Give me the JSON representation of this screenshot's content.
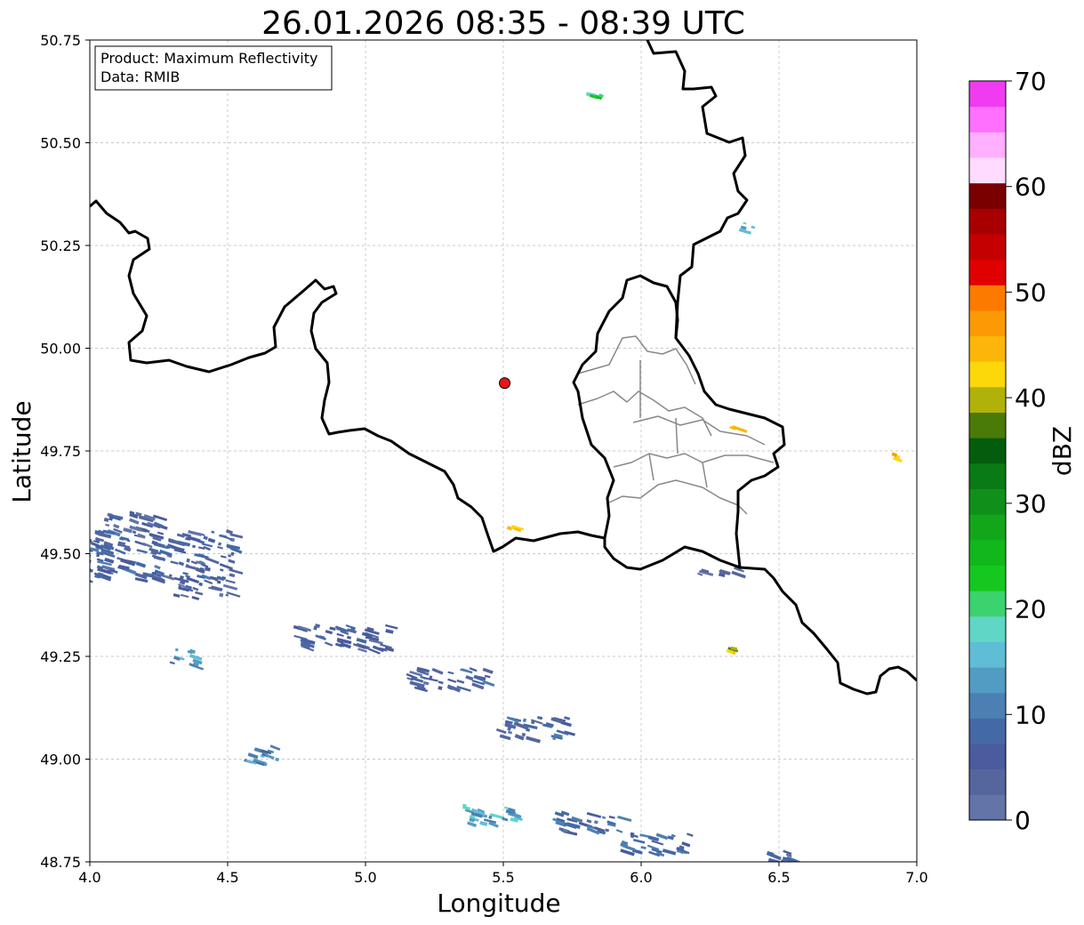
{
  "title": "26.01.2026 08:35 - 08:39 UTC",
  "legend": {
    "product_line": "Product: Maximum Reflectivity",
    "data_line": "Data: RMIB"
  },
  "axes": {
    "xlabel": "Longitude",
    "ylabel": "Latitude",
    "xlim": [
      4.0,
      7.0
    ],
    "ylim": [
      48.75,
      50.75
    ],
    "xticks": [
      "4.0",
      "4.5",
      "5.0",
      "5.5",
      "6.0",
      "6.5",
      "7.0"
    ],
    "yticks": [
      "48.75",
      "49.00",
      "49.25",
      "49.50",
      "49.75",
      "50.00",
      "50.25",
      "50.50",
      "50.75"
    ],
    "grid": true
  },
  "radar_site": {
    "lon": 5.505,
    "lat": 49.915,
    "color": "#e8151b"
  },
  "colorbar": {
    "label": "dBZ",
    "range": [
      0,
      70
    ],
    "tick_labels": [
      "0",
      "10",
      "20",
      "30",
      "40",
      "50",
      "60",
      "70"
    ],
    "colors": [
      "#6274a8",
      "#55669e",
      "#4a5c9d",
      "#4469a6",
      "#4c7fb2",
      "#529bc2",
      "#5fbdd6",
      "#5fd6c6",
      "#3bd36d",
      "#14c81f",
      "#12b71b",
      "#12a71a",
      "#10901a",
      "#0a7a15",
      "#045d0c",
      "#4a7a08",
      "#b0b20a",
      "#fcd70a",
      "#fcb60a",
      "#fc9a05",
      "#fc7a00",
      "#e00000",
      "#c40000",
      "#a80000",
      "#7a0000",
      "#ffdcff",
      "#ffb0ff",
      "#ff70ff",
      "#f03cf0"
    ]
  },
  "chart_data": {
    "type": "heatmap",
    "title": "26.01.2026 08:35 - 08:39 UTC",
    "xlabel": "Longitude",
    "ylabel": "Latitude",
    "xlim": [
      4.0,
      7.0
    ],
    "ylim": [
      48.75,
      50.75
    ],
    "value_label": "dBZ",
    "value_range": [
      0,
      70
    ],
    "echo_regions": [
      {
        "lon": 4.25,
        "lat": 49.5,
        "dlon": 0.55,
        "dlat": 0.12,
        "dbz": 6
      },
      {
        "lon": 4.15,
        "lat": 49.58,
        "dlon": 0.2,
        "dlat": 0.05,
        "dbz": 4
      },
      {
        "lon": 4.4,
        "lat": 49.42,
        "dlon": 0.2,
        "dlat": 0.05,
        "dbz": 5
      },
      {
        "lon": 4.9,
        "lat": 49.3,
        "dlon": 0.35,
        "dlat": 0.06,
        "dbz": 6
      },
      {
        "lon": 5.3,
        "lat": 49.2,
        "dlon": 0.3,
        "dlat": 0.05,
        "dbz": 6
      },
      {
        "lon": 5.6,
        "lat": 49.08,
        "dlon": 0.25,
        "dlat": 0.05,
        "dbz": 7
      },
      {
        "lon": 4.35,
        "lat": 49.25,
        "dlon": 0.12,
        "dlat": 0.04,
        "dbz": 12
      },
      {
        "lon": 4.62,
        "lat": 49.02,
        "dlon": 0.12,
        "dlat": 0.05,
        "dbz": 11
      },
      {
        "lon": 5.45,
        "lat": 48.87,
        "dlon": 0.2,
        "dlat": 0.05,
        "dbz": 14
      },
      {
        "lon": 5.8,
        "lat": 48.85,
        "dlon": 0.25,
        "dlat": 0.05,
        "dbz": 8
      },
      {
        "lon": 6.05,
        "lat": 48.8,
        "dlon": 0.25,
        "dlat": 0.05,
        "dbz": 9
      },
      {
        "lon": 6.5,
        "lat": 48.77,
        "dlon": 0.12,
        "dlat": 0.03,
        "dbz": 5
      },
      {
        "lon": 5.53,
        "lat": 49.57,
        "dlon": 0.03,
        "dlat": 0.01,
        "dbz": 43
      },
      {
        "lon": 6.32,
        "lat": 49.27,
        "dlon": 0.02,
        "dlat": 0.01,
        "dbz": 42
      },
      {
        "lon": 6.33,
        "lat": 49.81,
        "dlon": 0.02,
        "dlat": 0.01,
        "dbz": 42
      },
      {
        "lon": 6.92,
        "lat": 49.74,
        "dlon": 0.02,
        "dlat": 0.02,
        "dbz": 44
      },
      {
        "lon": 6.28,
        "lat": 49.46,
        "dlon": 0.2,
        "dlat": 0.02,
        "dbz": 3
      },
      {
        "lon": 6.38,
        "lat": 50.3,
        "dlon": 0.05,
        "dlat": 0.02,
        "dbz": 15
      },
      {
        "lon": 5.82,
        "lat": 50.62,
        "dlon": 0.06,
        "dlat": 0.01,
        "dbz": 22
      }
    ]
  }
}
